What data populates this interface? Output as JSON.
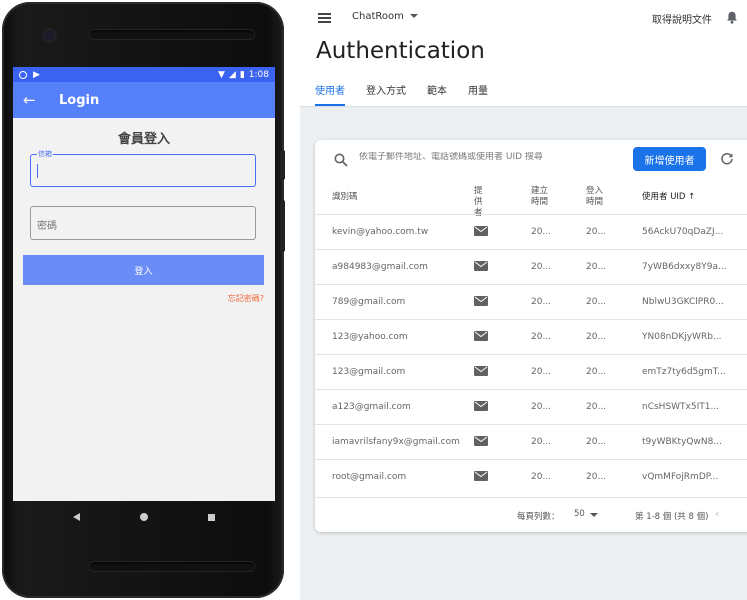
{
  "phone": {
    "status_time": "1:08",
    "appbar_title": "Login",
    "heading": "會員登入",
    "email_label": "信箱",
    "password_placeholder": "密碼",
    "login_button": "登入",
    "forgot_link": "忘記密碼?",
    "colors": {
      "statusbar": "#3a63f2",
      "appbar": "#5680fa",
      "button": "#6a8cf7",
      "forgot": "#f0683a"
    }
  },
  "console": {
    "project_name": "ChatRoom",
    "docs_link": "取得說明文件",
    "page_title": "Authentication",
    "tabs": [
      {
        "label": "使用者",
        "active": true
      },
      {
        "label": "登入方式",
        "active": false
      },
      {
        "label": "範本",
        "active": false
      },
      {
        "label": "用量",
        "active": false
      }
    ],
    "search_placeholder": "依電子郵件地址、電話號碼或使用者 UID 搜尋",
    "add_user_button": "新增使用者",
    "columns": {
      "identifier": "識別碼",
      "provider": "提供者",
      "created": "建立時間",
      "signed_in": "登入時間",
      "uid": "使用者 UID ↑"
    },
    "users": [
      {
        "identifier": "kevin@yahoo.com.tw",
        "provider_icon": "mail-icon",
        "created": "20...",
        "signed_in": "20...",
        "uid": "56AckU70qDaZJ..."
      },
      {
        "identifier": "a984983@gmail.com",
        "provider_icon": "mail-icon",
        "created": "20...",
        "signed_in": "20...",
        "uid": "7yWB6dxxy8Y9a..."
      },
      {
        "identifier": "789@gmail.com",
        "provider_icon": "mail-icon",
        "created": "20...",
        "signed_in": "20...",
        "uid": "NblwU3GKClPR0..."
      },
      {
        "identifier": "123@yahoo.com",
        "provider_icon": "mail-icon",
        "created": "20...",
        "signed_in": "20...",
        "uid": "YN08nDKjyWRb..."
      },
      {
        "identifier": "123@gmail.com",
        "provider_icon": "mail-icon",
        "created": "20...",
        "signed_in": "20...",
        "uid": "emTz7ty6d5gmT..."
      },
      {
        "identifier": "a123@gmail.com",
        "provider_icon": "mail-icon",
        "created": "20...",
        "signed_in": "20...",
        "uid": "nCsHSWTx5IT1..."
      },
      {
        "identifier": "iamavrilsfany9x@gmail.com",
        "provider_icon": "mail-icon",
        "created": "20...",
        "signed_in": "20...",
        "uid": "t9yWBKtyQwN8..."
      },
      {
        "identifier": "root@gmail.com",
        "provider_icon": "mail-icon",
        "created": "20...",
        "signed_in": "20...",
        "uid": "vQmMFojRmDP..."
      }
    ],
    "footer": {
      "rows_per_page_label": "每頁列數：",
      "rows_per_page_value": "50",
      "range": "第 1-8 個 (共 8 個)"
    },
    "colors": {
      "accent": "#1a73e8"
    }
  }
}
